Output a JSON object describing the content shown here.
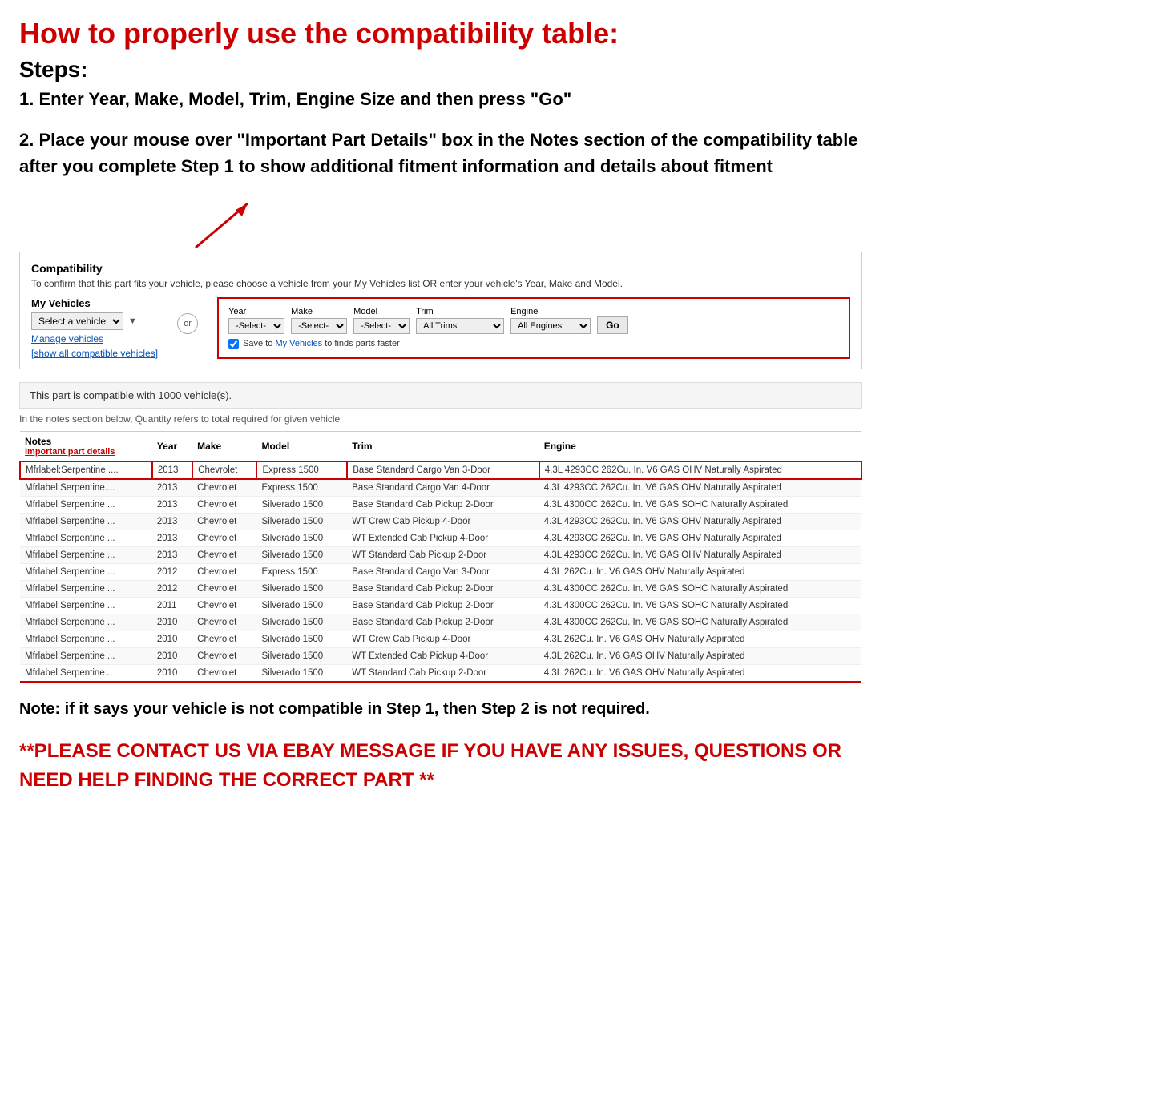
{
  "page": {
    "main_title": "How to properly use the compatibility table:",
    "steps_heading": "Steps:",
    "step1": "1. Enter Year, Make, Model, Trim, Engine Size and then press \"Go\"",
    "step2": "2. Place your mouse over \"Important Part Details\" box in the Notes section of the compatibility table after you complete Step 1 to show additional fitment information and details about fitment",
    "note": "Note: if it says your vehicle is not compatible in Step 1, then Step 2 is not required.",
    "contact": "**PLEASE CONTACT US VIA EBAY MESSAGE IF YOU HAVE ANY ISSUES, QUESTIONS OR NEED HELP FINDING THE CORRECT PART **"
  },
  "compatibility": {
    "title": "Compatibility",
    "description": "To confirm that this part fits your vehicle, please choose a vehicle from your My Vehicles list OR enter your vehicle's Year, Make and Model.",
    "my_vehicles_label": "My Vehicles",
    "select_vehicle_placeholder": "Select a vehicle",
    "manage_vehicles": "Manage vehicles",
    "show_all": "[show all compatible vehicles]",
    "or_label": "or",
    "year_label": "Year",
    "year_placeholder": "-Select-",
    "make_label": "Make",
    "make_placeholder": "-Select-",
    "model_label": "Model",
    "model_placeholder": "-Select-",
    "trim_label": "Trim",
    "trim_placeholder": "All Trims",
    "engine_label": "Engine",
    "engine_placeholder": "All Engines",
    "go_button": "Go",
    "save_text": "Save to My Vehicles to finds parts faster",
    "save_my_vehicles": "My Vehicles",
    "compat_count": "This part is compatible with 1000 vehicle(s).",
    "quantity_note": "In the notes section below, Quantity refers to total required for given vehicle"
  },
  "table": {
    "columns": [
      "Notes",
      "Year",
      "Make",
      "Model",
      "Trim",
      "Engine"
    ],
    "notes_sublabel": "Important part details",
    "rows": [
      {
        "notes": "Mfrlabel:Serpentine ....",
        "year": "2013",
        "make": "Chevrolet",
        "model": "Express 1500",
        "trim": "Base Standard Cargo Van 3-Door",
        "engine": "4.3L 4293CC 262Cu. In. V6 GAS OHV Naturally Aspirated",
        "highlighted": true
      },
      {
        "notes": "Mfrlabel:Serpentine....",
        "year": "2013",
        "make": "Chevrolet",
        "model": "Express 1500",
        "trim": "Base Standard Cargo Van 4-Door",
        "engine": "4.3L 4293CC 262Cu. In. V6 GAS OHV Naturally Aspirated",
        "highlighted": false
      },
      {
        "notes": "Mfrlabel:Serpentine ...",
        "year": "2013",
        "make": "Chevrolet",
        "model": "Silverado 1500",
        "trim": "Base Standard Cab Pickup 2-Door",
        "engine": "4.3L 4300CC 262Cu. In. V6 GAS SOHC Naturally Aspirated",
        "highlighted": false
      },
      {
        "notes": "Mfrlabel:Serpentine ...",
        "year": "2013",
        "make": "Chevrolet",
        "model": "Silverado 1500",
        "trim": "WT Crew Cab Pickup 4-Door",
        "engine": "4.3L 4293CC 262Cu. In. V6 GAS OHV Naturally Aspirated",
        "highlighted": false
      },
      {
        "notes": "Mfrlabel:Serpentine ...",
        "year": "2013",
        "make": "Chevrolet",
        "model": "Silverado 1500",
        "trim": "WT Extended Cab Pickup 4-Door",
        "engine": "4.3L 4293CC 262Cu. In. V6 GAS OHV Naturally Aspirated",
        "highlighted": false
      },
      {
        "notes": "Mfrlabel:Serpentine ...",
        "year": "2013",
        "make": "Chevrolet",
        "model": "Silverado 1500",
        "trim": "WT Standard Cab Pickup 2-Door",
        "engine": "4.3L 4293CC 262Cu. In. V6 GAS OHV Naturally Aspirated",
        "highlighted": false
      },
      {
        "notes": "Mfrlabel:Serpentine ...",
        "year": "2012",
        "make": "Chevrolet",
        "model": "Express 1500",
        "trim": "Base Standard Cargo Van 3-Door",
        "engine": "4.3L 262Cu. In. V6 GAS OHV Naturally Aspirated",
        "highlighted": false
      },
      {
        "notes": "Mfrlabel:Serpentine ...",
        "year": "2012",
        "make": "Chevrolet",
        "model": "Silverado 1500",
        "trim": "Base Standard Cab Pickup 2-Door",
        "engine": "4.3L 4300CC 262Cu. In. V6 GAS SOHC Naturally Aspirated",
        "highlighted": false
      },
      {
        "notes": "Mfrlabel:Serpentine ...",
        "year": "2011",
        "make": "Chevrolet",
        "model": "Silverado 1500",
        "trim": "Base Standard Cab Pickup 2-Door",
        "engine": "4.3L 4300CC 262Cu. In. V6 GAS SOHC Naturally Aspirated",
        "highlighted": false
      },
      {
        "notes": "Mfrlabel:Serpentine ...",
        "year": "2010",
        "make": "Chevrolet",
        "model": "Silverado 1500",
        "trim": "Base Standard Cab Pickup 2-Door",
        "engine": "4.3L 4300CC 262Cu. In. V6 GAS SOHC Naturally Aspirated",
        "highlighted": false
      },
      {
        "notes": "Mfrlabel:Serpentine ...",
        "year": "2010",
        "make": "Chevrolet",
        "model": "Silverado 1500",
        "trim": "WT Crew Cab Pickup 4-Door",
        "engine": "4.3L 262Cu. In. V6 GAS OHV Naturally Aspirated",
        "highlighted": false
      },
      {
        "notes": "Mfrlabel:Serpentine ...",
        "year": "2010",
        "make": "Chevrolet",
        "model": "Silverado 1500",
        "trim": "WT Extended Cab Pickup 4-Door",
        "engine": "4.3L 262Cu. In. V6 GAS OHV Naturally Aspirated",
        "highlighted": false
      },
      {
        "notes": "Mfrlabel:Serpentine...",
        "year": "2010",
        "make": "Chevrolet",
        "model": "Silverado 1500",
        "trim": "WT Standard Cab Pickup 2-Door",
        "engine": "4.3L 262Cu. In. V6 GAS OHV Naturally Aspirated",
        "highlighted": false,
        "cut": true
      }
    ]
  },
  "colors": {
    "red": "#cc0000",
    "link_blue": "#0654ba",
    "table_border": "#cccccc",
    "highlight_border": "#cc0000"
  }
}
